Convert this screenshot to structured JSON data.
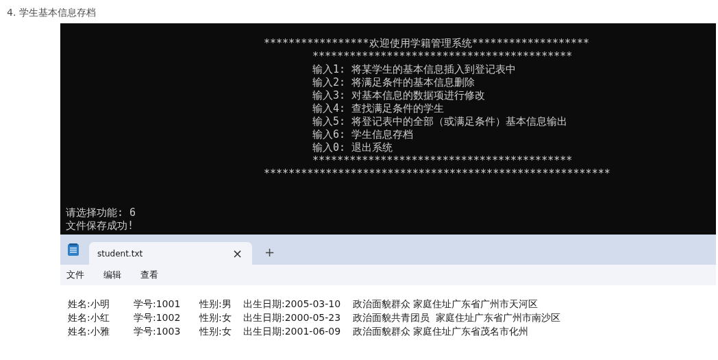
{
  "heading": "4. 学生基本信息存档",
  "console": {
    "lines": [
      {
        "kind": "banner",
        "text": "*****************欢迎使用学籍管理系统*******************"
      },
      {
        "kind": "menu",
        "text": "******************************************"
      },
      {
        "kind": "menu",
        "text": "输入1: 将某学生的基本信息插入到登记表中"
      },
      {
        "kind": "menu",
        "text": "输入2: 将满足条件的基本信息删除"
      },
      {
        "kind": "menu",
        "text": "输入3: 对基本信息的数据项进行修改"
      },
      {
        "kind": "menu",
        "text": "输入4: 查找满足条件的学生"
      },
      {
        "kind": "menu",
        "text": "输入5: 将登记表中的全部（或满足条件）基本信息输出"
      },
      {
        "kind": "menu",
        "text": "输入6: 学生信息存档"
      },
      {
        "kind": "menu",
        "text": "输入0: 退出系统"
      },
      {
        "kind": "menu",
        "text": "******************************************"
      },
      {
        "kind": "banner",
        "text": "********************************************************"
      },
      {
        "kind": "blank"
      },
      {
        "kind": "blank"
      },
      {
        "kind": "prompt",
        "text": "请选择功能: 6"
      },
      {
        "kind": "prompt",
        "text": "文件保存成功!"
      }
    ]
  },
  "notepad": {
    "tabs": [
      {
        "label": "student.txt",
        "selected": true,
        "close": "×"
      }
    ],
    "new_tab": "+",
    "menu": [
      "文件",
      "编辑",
      "查看"
    ],
    "rows": [
      [
        "姓名:小明",
        "学号:1001",
        "性别:男",
        "出生日期:2005-03-10",
        "政治面貌群众 家庭住址广东省广州市天河区"
      ],
      [
        "姓名:小红",
        "学号:1002",
        "性别:女",
        "出生日期:2000-05-23",
        "政治面貌共青团员  家庭住址广东省广州市南沙区"
      ],
      [
        "姓名:小雅",
        "学号:1003",
        "性别:女",
        "出生日期:2001-06-09",
        "政治面貌群众 家庭住址广东省茂名市化州"
      ]
    ]
  }
}
